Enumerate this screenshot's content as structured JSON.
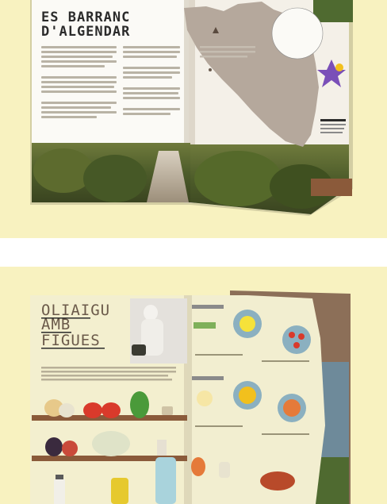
{
  "top_magazine": {
    "title_line1": "ES BARRANC",
    "title_line2": "D'ALGENDAR"
  },
  "bottom_magazine": {
    "title_line1": "OLIAIGU",
    "title_line2": "AMB",
    "title_line3": "FIGUES"
  },
  "colors": {
    "background": "#f8f2c0",
    "separator": "#ffffff",
    "map_land": "#b5a89c",
    "tomato_red": "#d93a2b",
    "pepper_green": "#4a9a3a",
    "shelf_brown": "#8a5a3a"
  }
}
